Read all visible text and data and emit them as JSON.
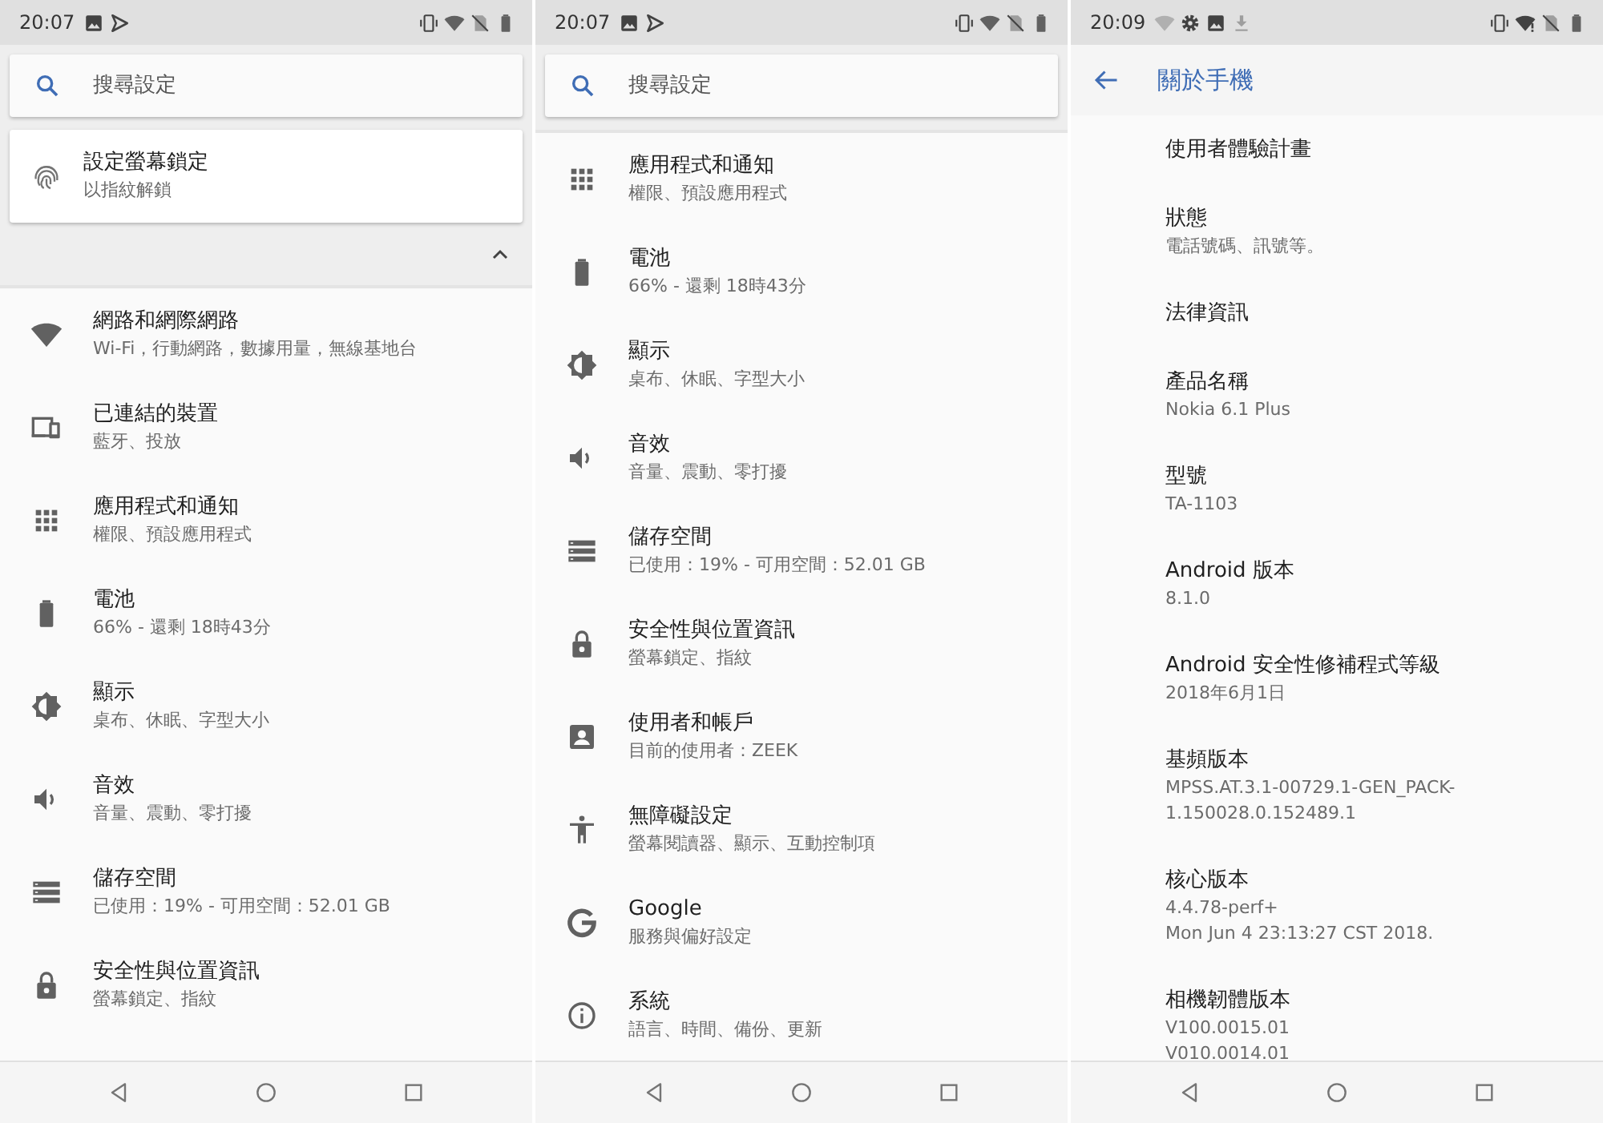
{
  "screens": [
    {
      "status_bar": {
        "time": "20:07",
        "left_icons": [
          {
            "kind": "image"
          },
          {
            "kind": "play"
          }
        ],
        "right_icons": [
          {
            "kind": "vibrate"
          },
          {
            "kind": "wifi"
          },
          {
            "kind": "nosim"
          },
          {
            "kind": "battery"
          }
        ]
      },
      "search": {
        "placeholder": "搜尋設定"
      },
      "suggestion": {
        "kind": "fingerprint",
        "title": "設定螢幕鎖定",
        "subtitle": "以指紋解鎖"
      },
      "suggestions_expanded": true,
      "items": [
        {
          "kind": "wifi",
          "title": "網路和網際網路",
          "subtitle": "Wi-Fi，行動網路，數據用量，無線基地台"
        },
        {
          "kind": "devices",
          "title": "已連結的裝置",
          "subtitle": "藍牙、投放"
        },
        {
          "kind": "apps",
          "title": "應用程式和通知",
          "subtitle": "權限、預設應用程式"
        },
        {
          "kind": "battery",
          "title": "電池",
          "subtitle": "66% - 還剩 18時43分"
        },
        {
          "kind": "display",
          "title": "顯示",
          "subtitle": "桌布、休眠、字型大小"
        },
        {
          "kind": "sound",
          "title": "音效",
          "subtitle": "音量、震動、零打擾"
        },
        {
          "kind": "storage",
          "title": "儲存空間",
          "subtitle": "已使用：19% - 可用空間：52.01 GB"
        },
        {
          "kind": "lock",
          "title": "安全性與位置資訊",
          "subtitle": "螢幕鎖定、指紋"
        }
      ]
    },
    {
      "status_bar": {
        "time": "20:07",
        "left_icons": [
          {
            "kind": "image"
          },
          {
            "kind": "play"
          }
        ],
        "right_icons": [
          {
            "kind": "vibrate"
          },
          {
            "kind": "wifi"
          },
          {
            "kind": "nosim"
          },
          {
            "kind": "battery"
          }
        ]
      },
      "search": {
        "placeholder": "搜尋設定"
      },
      "items": [
        {
          "kind": "apps",
          "title": "應用程式和通知",
          "subtitle": "權限、預設應用程式"
        },
        {
          "kind": "battery",
          "title": "電池",
          "subtitle": "66% - 還剩 18時43分"
        },
        {
          "kind": "display",
          "title": "顯示",
          "subtitle": "桌布、休眠、字型大小"
        },
        {
          "kind": "sound",
          "title": "音效",
          "subtitle": "音量、震動、零打擾"
        },
        {
          "kind": "storage",
          "title": "儲存空間",
          "subtitle": "已使用：19% - 可用空間：52.01 GB"
        },
        {
          "kind": "lock",
          "title": "安全性與位置資訊",
          "subtitle": "螢幕鎖定、指紋"
        },
        {
          "kind": "account",
          "title": "使用者和帳戶",
          "subtitle": "目前的使用者：ZEEK"
        },
        {
          "kind": "accessibility",
          "title": "無障礙設定",
          "subtitle": "螢幕閱讀器、顯示、互動控制項"
        },
        {
          "kind": "logo",
          "title": "Google",
          "subtitle": "服務與偏好設定"
        },
        {
          "kind": "info",
          "title": "系統",
          "subtitle": "語言、時間、備份、更新"
        }
      ]
    },
    {
      "status_bar": {
        "time": "20:09",
        "left_icons": [
          {
            "kind": "wifi-faded"
          },
          {
            "kind": "gear"
          },
          {
            "kind": "image"
          },
          {
            "kind": "download"
          }
        ],
        "right_icons": [
          {
            "kind": "vibrate"
          },
          {
            "kind": "wifi-alert"
          },
          {
            "kind": "nosim"
          },
          {
            "kind": "battery"
          }
        ]
      },
      "toolbar": {
        "title": "關於手機"
      },
      "details": [
        {
          "title": "使用者體驗計畫"
        },
        {
          "title": "狀態",
          "lines": [
            "電話號碼、訊號等。"
          ]
        },
        {
          "title": "法律資訊"
        },
        {
          "title": "產品名稱",
          "lines": [
            "Nokia 6.1 Plus"
          ]
        },
        {
          "title": "型號",
          "lines": [
            "TA-1103"
          ]
        },
        {
          "title": "Android 版本",
          "lines": [
            "8.1.0"
          ]
        },
        {
          "title": "Android 安全性修補程式等級",
          "lines": [
            "2018年6月1日"
          ]
        },
        {
          "title": "基頻版本",
          "lines": [
            "MPSS.AT.3.1-00729.1-GEN_PACK-",
            "1.150028.0.152489.1"
          ]
        },
        {
          "title": "核心版本",
          "lines": [
            "4.4.78-perf+",
            "Mon Jun 4 23:13:27 CST 2018."
          ]
        },
        {
          "title": "相機韌體版本",
          "lines": [
            "V100.0015.01",
            "V010.0014.01"
          ]
        }
      ]
    }
  ]
}
